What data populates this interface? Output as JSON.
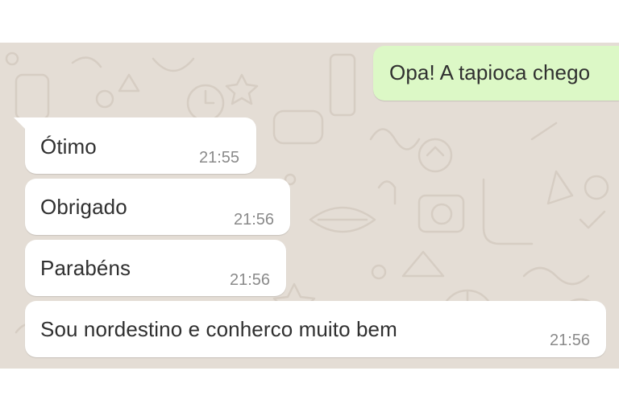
{
  "conversation": {
    "messages": [
      {
        "direction": "outgoing",
        "text": "Opa! A tapioca chego"
      },
      {
        "direction": "incoming",
        "text": "Ótimo",
        "time": "21:55"
      },
      {
        "direction": "incoming",
        "text": "Obrigado",
        "time": "21:56"
      },
      {
        "direction": "incoming",
        "text": "Parabéns",
        "time": "21:56"
      },
      {
        "direction": "incoming",
        "text": "Sou nordestino e conherco muito bem",
        "time": "21:56"
      }
    ]
  },
  "colors": {
    "wallpaper": "#e4ddd5",
    "incoming_bubble": "#ffffff",
    "outgoing_bubble": "#dcf8c6",
    "message_text": "#303030",
    "timestamp_text": "#8a8a8a"
  }
}
